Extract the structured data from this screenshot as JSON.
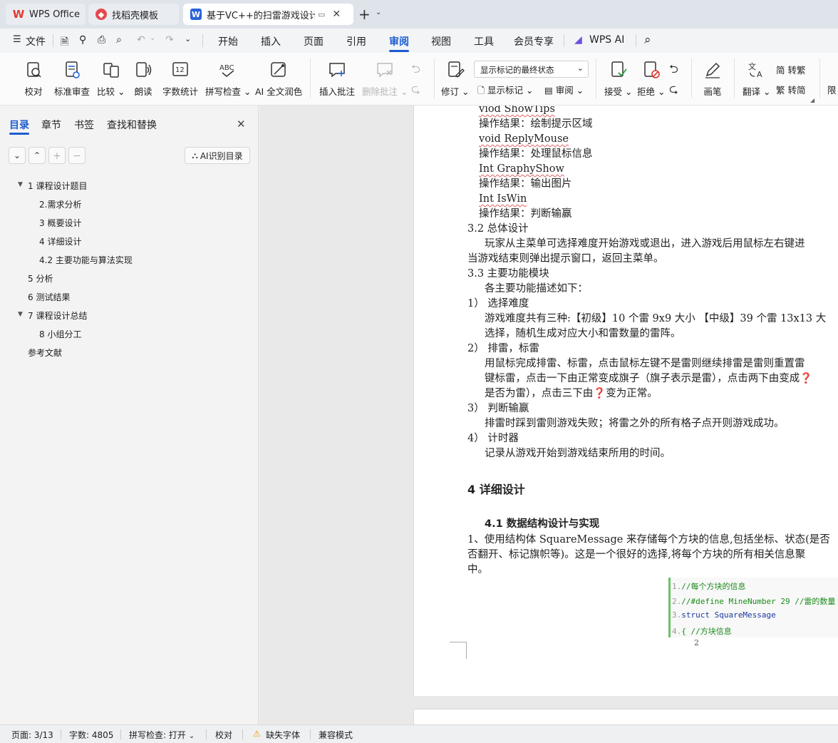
{
  "tabs": [
    {
      "label": "WPS Office",
      "icon": "wps-logo-icon"
    },
    {
      "label": "找稻壳模板",
      "icon": "docer-icon"
    },
    {
      "label": "基于VC++的扫雷游戏设计 课",
      "icon": "word-doc-icon"
    }
  ],
  "menu": {
    "file": "文件",
    "items": [
      "开始",
      "插入",
      "页面",
      "引用",
      "审阅",
      "视图",
      "工具",
      "会员专享"
    ],
    "active": "审阅",
    "wps_ai": "WPS AI"
  },
  "ribbon": {
    "proofread": "校对",
    "standard_review": "标准审查",
    "compare": "比较",
    "read_aloud": "朗读",
    "word_count": "字数统计",
    "spell_check": "拼写检查",
    "ai_polish": "AI 全文润色",
    "insert_comment": "插入批注",
    "delete_comment": "删除批注",
    "revise": "修订",
    "show_markup_select": "显示标记的最终状态",
    "show_markup": "显示标记",
    "review": "审阅",
    "accept": "接受",
    "reject": "拒绝",
    "pen": "画笔",
    "translate": "翻译",
    "to_traditional": "转繁",
    "to_simplified": "转简",
    "limit": "限"
  },
  "sidebar": {
    "tabs": [
      "目录",
      "章节",
      "书签",
      "查找和替换"
    ],
    "active_tab": "目录",
    "ai_toc": "AI识别目录",
    "toc": [
      {
        "label": "1  课程设计题目",
        "expanded": true
      },
      {
        "label": "2.需求分析"
      },
      {
        "label": "3  概要设计"
      },
      {
        "label": "4 详细设计"
      },
      {
        "label": "4.2  主要功能与算法实现"
      },
      {
        "label": "5  分析"
      },
      {
        "label": "6  测试结果"
      },
      {
        "label": "7    课程设计总结",
        "expanded": true
      },
      {
        "label": "8  小组分工"
      },
      {
        "label": "参考文献"
      }
    ]
  },
  "document": {
    "lines": [
      "viod ShowTips",
      "操作结果：绘制提示区域",
      "void ReplyMouse",
      "操作结果：处理鼠标信息",
      "Int GraphyShow",
      "操作结果：输出图片",
      "Int IsWin",
      "操作结果：判断输赢",
      "3.2 总体设计",
      "玩家从主菜单可选择难度开始游戏或退出，进入游戏后用鼠标左右键进",
      "当游戏结束则弹出提示窗口，返回主菜单。",
      "3.3 主要功能模块",
      "各主要功能描述如下：",
      "1）  选择难度",
      "游戏难度共有三种:【初级】10 个雷 9x9 大小  【中级】39 个雷 13x13 大",
      "选择，随机生成对应大小和雷数量的雷阵。",
      "2）  排雷，标雷",
      "用鼠标完成排雷、标雷，点击鼠标左键不是雷则继续排雷是雷则重置雷",
      "键标雷，点击一下由正常变成旗子（旗子表示是雷），点击两下由变成❓",
      "是否为雷），点击三下由❓变为正常。",
      "3）  判断输赢",
      "排雷时踩到雷则游戏失败；将雷之外的所有格子点开则游戏成功。",
      "4）  计时器",
      "记录从游戏开始到游戏结束所用的时间。"
    ],
    "heading4": "4 详细设计",
    "heading41": "4.1  数据结构设计与实现",
    "para1": [
      "1、使用结构体 SquareMessage 来存储每个方块的信息,包括坐标、状态(是否",
      "否翻开、标记旗帜等)。这是一个很好的选择,将每个方块的所有相关信息聚",
      "中。"
    ],
    "code": [
      {
        "num": "1.",
        "text": "//每个方块的信息"
      },
      {
        "num": "2.",
        "text": "//#define MineNumber 29        //雷的数量"
      },
      {
        "num": "3.",
        "text": "struct SquareMessage"
      },
      {
        "num": "4.",
        "text": "{ //方块信息"
      }
    ],
    "page_number": "2"
  },
  "status": {
    "page": "页面: 3/13",
    "words": "字数: 4805",
    "spell": "拼写检查: 打开",
    "proof": "校对",
    "missing_font": "缺失字体",
    "compat": "兼容模式"
  },
  "colors": {
    "accent": "#1c5cd1",
    "wps_red": "#e33b2e",
    "code_green": "#1a8a1a"
  }
}
